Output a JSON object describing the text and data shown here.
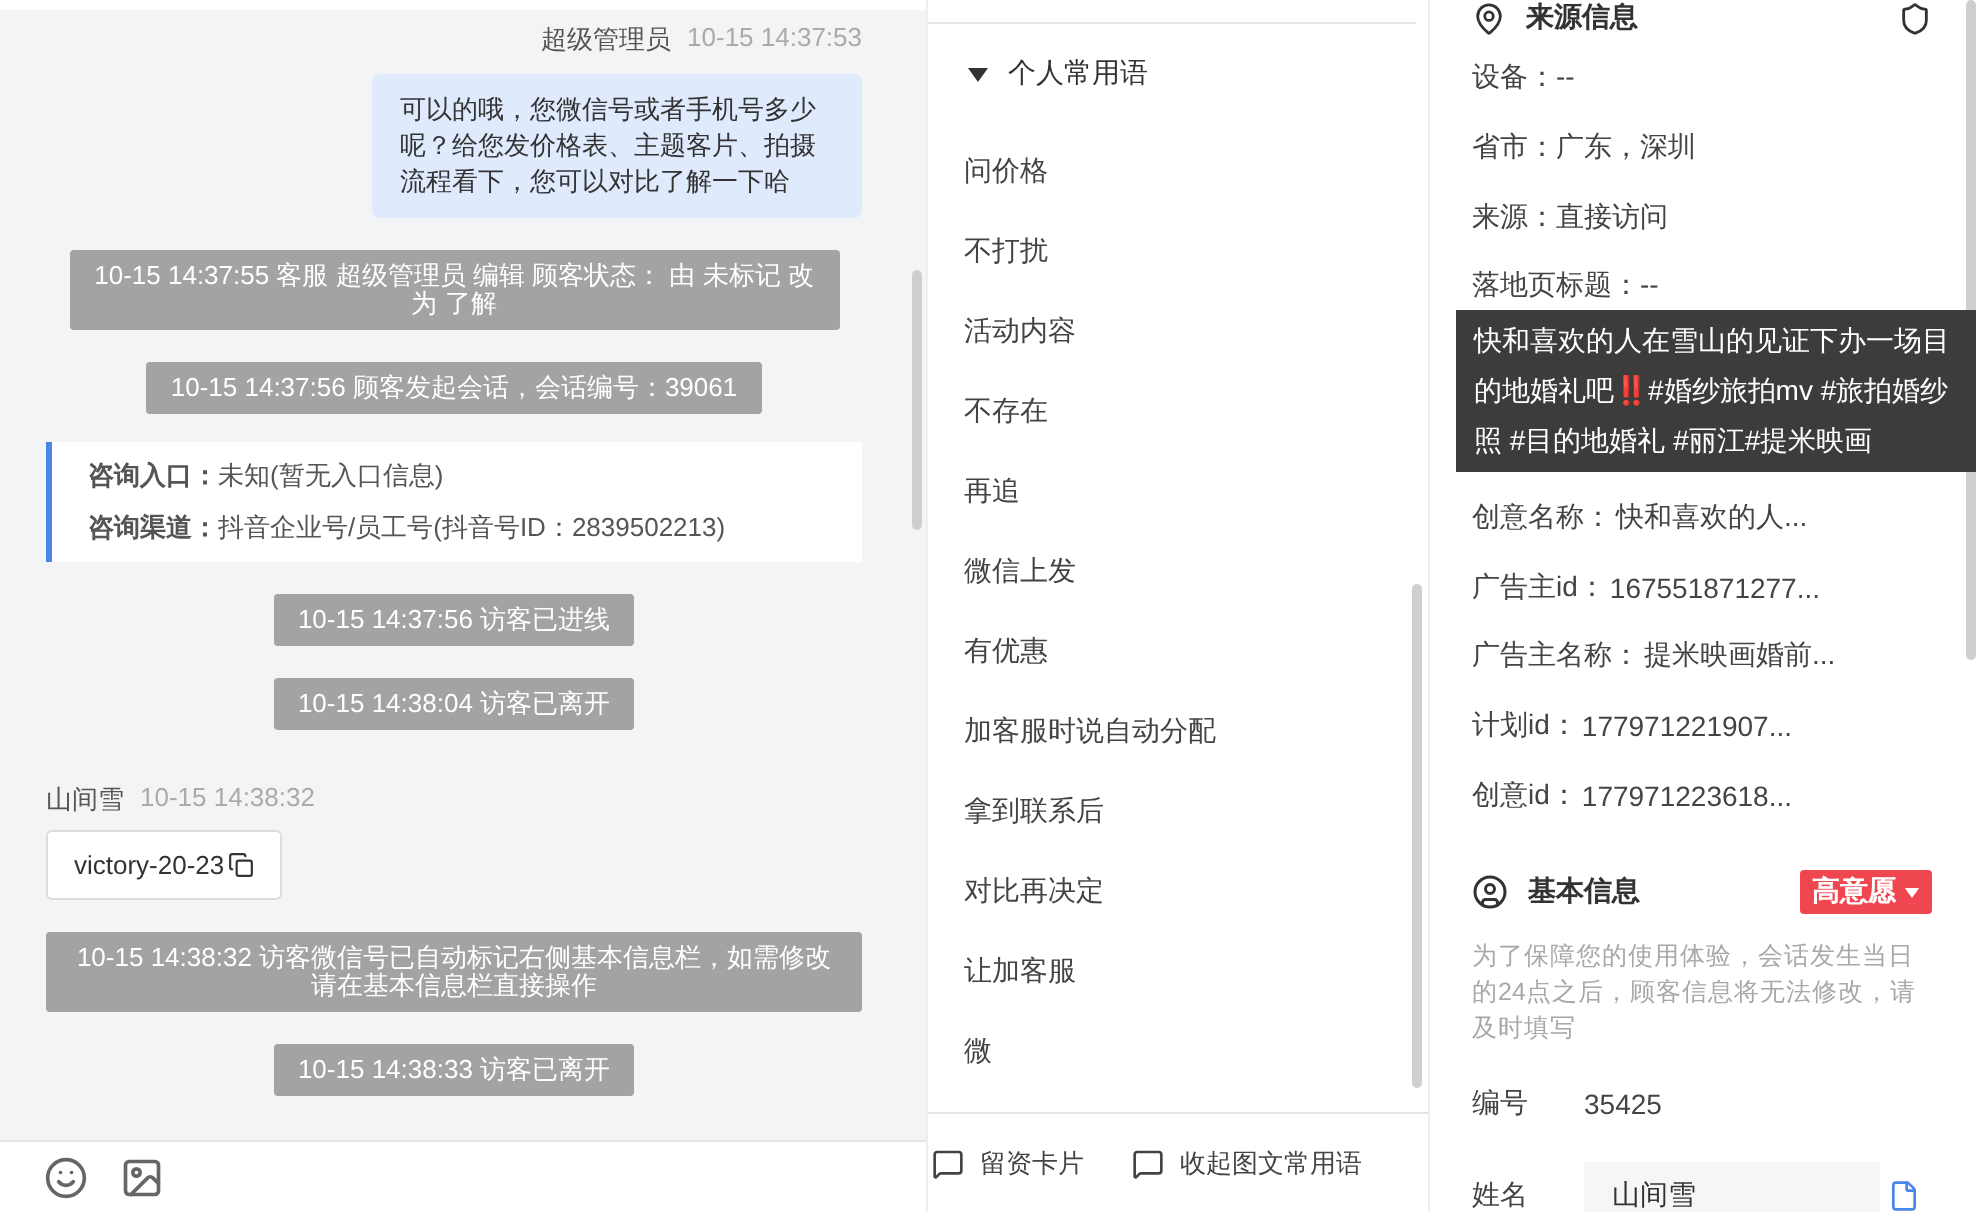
{
  "chat": {
    "messages": [
      {
        "kind": "agent",
        "sender": "超级管理员",
        "time": "10-15 14:37:53",
        "text": "可以的哦，您微信号或者手机号多少呢？给您发价格表、主题客片、拍摄流程看下，您可以对比了解一下哈"
      },
      {
        "kind": "system",
        "text": "10-15 14:37:55 客服 超级管理员 编辑 顾客状态： 由 未标记 改为 了解"
      },
      {
        "kind": "system",
        "text": "10-15 14:37:56 顾客发起会话，会话编号：39061"
      },
      {
        "kind": "info",
        "lines": [
          {
            "label": "咨询入口：",
            "value": "未知(暂无入口信息)"
          },
          {
            "label": "咨询渠道：",
            "value": "抖音企业号/员工号(抖音号ID：2839502213)"
          }
        ]
      },
      {
        "kind": "system",
        "text": "10-15 14:37:56 访客已进线"
      },
      {
        "kind": "system",
        "text": "10-15 14:38:04 访客已离开"
      },
      {
        "kind": "visitor",
        "sender": "山间雪",
        "time": "10-15 14:38:32",
        "text": "victory-20-23"
      },
      {
        "kind": "system",
        "text": "10-15 14:38:32 访客微信号已自动标记右侧基本信息栏，如需修改请在基本信息栏直接操作"
      },
      {
        "kind": "system",
        "text": "10-15 14:38:33 访客已离开"
      }
    ]
  },
  "phrases": {
    "group": {
      "label": "个人常用语",
      "expanded": true
    },
    "items": [
      "问价格",
      "不打扰",
      "活动内容",
      "不存在",
      "再追",
      "微信上发",
      "有优惠",
      "加客服时说自动分配",
      "拿到联系后",
      "对比再决定",
      "让加客服",
      "微"
    ],
    "actions": [
      "留资卡片",
      "收起图文常用语"
    ]
  },
  "source_info": {
    "title": "来源信息",
    "rows_before": [
      "设备：--",
      "省市：广东，深圳",
      "来源：直接访问",
      "落地页标题：--"
    ],
    "tooltip": "快和喜欢的人在雪山的见证下办一场目的地婚礼吧‼️#婚纱旅拍mv #旅拍婚纱照 #目的地婚礼 #丽江#提米映画",
    "rows_after": [
      {
        "label": "创意名称：",
        "value": "快和喜欢的人..."
      },
      {
        "label": "广告主id：",
        "value": "167551871277..."
      },
      {
        "label": "广告主名称：",
        "value": "提米映画婚前..."
      },
      {
        "label": "计划id：",
        "value": "177971221907..."
      },
      {
        "label": "创意id：",
        "value": "177971223618..."
      }
    ]
  },
  "basic_info": {
    "title": "基本信息",
    "intent_tag": "高意愿",
    "note": "为了保障您的使用体验，会话发生当日的24点之后，顾客信息将无法修改，请及时填写",
    "fields": [
      {
        "kind": "text",
        "label": "编号",
        "value": "35425"
      },
      {
        "kind": "input",
        "label": "姓名",
        "value": "山间雪"
      }
    ]
  }
}
